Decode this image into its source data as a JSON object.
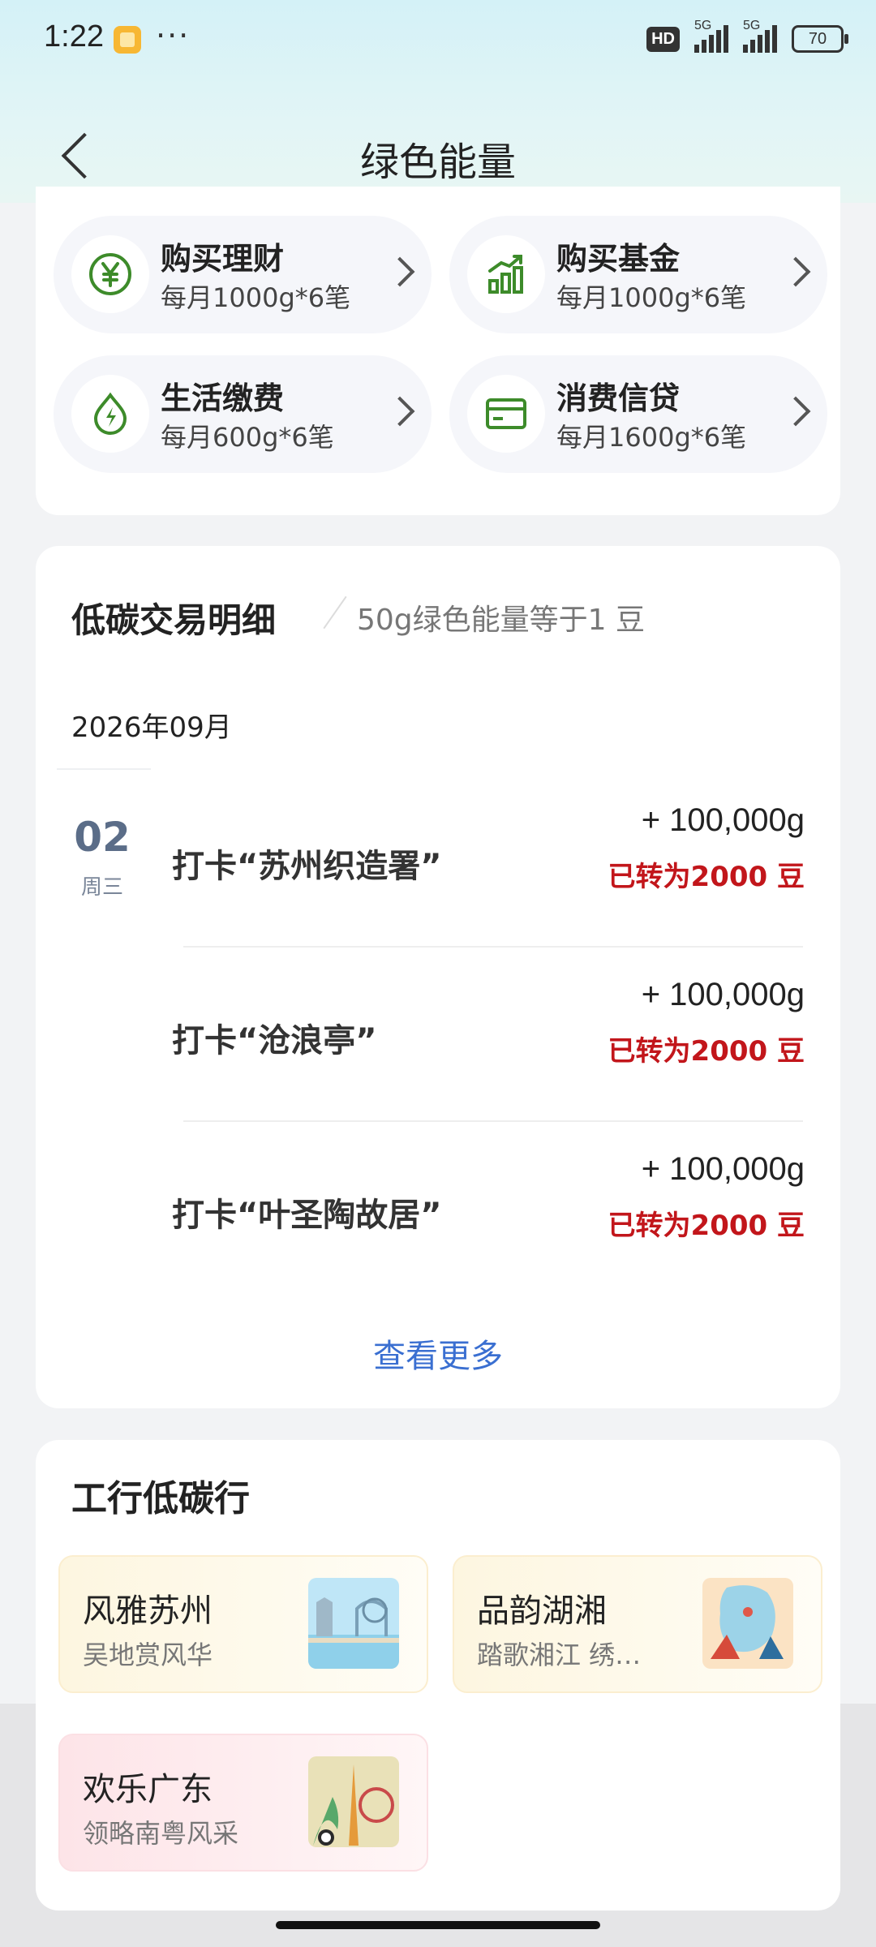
{
  "status_bar": {
    "time": "1:22",
    "more": "···",
    "hd": "HD",
    "net1": "5G",
    "net2": "5G",
    "battery": "70"
  },
  "nav": {
    "title": "绿色能量"
  },
  "services": [
    {
      "title": "购买理财",
      "sub": "每月1000g*6笔",
      "icon": "yen-icon"
    },
    {
      "title": "购买基金",
      "sub": "每月1000g*6笔",
      "icon": "growth-chart-icon"
    },
    {
      "title": "生活缴费",
      "sub": "每月600g*6笔",
      "icon": "energy-drop-icon"
    },
    {
      "title": "消费信贷",
      "sub": "每月1600g*6笔",
      "icon": "card-icon"
    }
  ],
  "detail": {
    "title": "低碳交易明细",
    "subtitle": "50g绿色能量等于1 豆",
    "month": "2026年09月",
    "day": "02",
    "weekday": "周三",
    "transactions": [
      {
        "name": "打卡“苏州织造署”",
        "amount": "+ 100,000g",
        "converted": "已转为2000 豆"
      },
      {
        "name": "打卡“沧浪亭”",
        "amount": "+ 100,000g",
        "converted": "已转为2000 豆"
      },
      {
        "name": "打卡“叶圣陶故居”",
        "amount": "+ 100,000g",
        "converted": "已转为2000 豆"
      }
    ],
    "more": "查看更多"
  },
  "low_carbon": {
    "title": "工行低碳行",
    "routes": [
      {
        "title": "风雅苏州",
        "sub": "吴地赏风华"
      },
      {
        "title": "品韵湖湘",
        "sub": "踏歌湘江 绣…"
      },
      {
        "title": "欢乐广东",
        "sub": "领略南粤风采"
      }
    ]
  },
  "colors": {
    "accent_green": "#3d8b2a",
    "red": "#c2161b",
    "link_blue": "#3a6fd1"
  }
}
